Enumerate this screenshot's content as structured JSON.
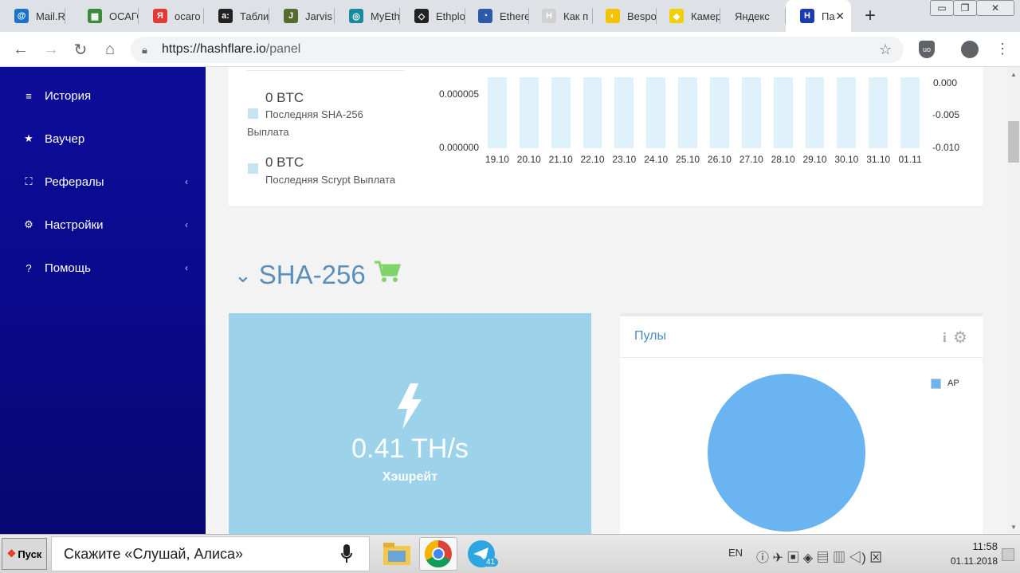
{
  "browser": {
    "tabs": [
      {
        "label": "Mail.Ru",
        "favicon": "@",
        "color": "#1a73c9"
      },
      {
        "label": "ОСАГО",
        "favicon": "▦",
        "color": "#3c8a3c"
      },
      {
        "label": "осаго",
        "favicon": "Я",
        "color": "#e53935"
      },
      {
        "label": "Табли",
        "favicon": "a:",
        "color": "#222222"
      },
      {
        "label": "Jarvis",
        "favicon": "J",
        "color": "#556b2f"
      },
      {
        "label": "MyEth",
        "favicon": "◎",
        "color": "#1b8a9c"
      },
      {
        "label": "Ethplo",
        "favicon": "◇",
        "color": "#222222"
      },
      {
        "label": "Ethere",
        "favicon": "◔",
        "color": "#2d5aa6"
      },
      {
        "label": "Как п",
        "favicon": "H",
        "color": "#d0d0d0"
      },
      {
        "label": "Bespo",
        "favicon": "◐",
        "color": "#f3c200"
      },
      {
        "label": "Камер",
        "favicon": "◆",
        "color": "#f0d000"
      },
      {
        "label": "Яндекс",
        "favicon": "",
        "color": "#dee1e6"
      },
      {
        "label": "Па",
        "favicon": "H",
        "color": "#1c3bb0",
        "active": true
      }
    ],
    "new_tab": "+",
    "url_host": "https://hashflare.io",
    "url_path": "/panel",
    "window_controls": [
      "minimize",
      "restore",
      "close"
    ]
  },
  "sidebar": {
    "items": [
      {
        "label": "История",
        "icon": "list-icon",
        "glyph": "≡",
        "submenu": false
      },
      {
        "label": "Ваучер",
        "icon": "star-icon",
        "glyph": "★",
        "submenu": false
      },
      {
        "label": "Рефералы",
        "icon": "network-icon",
        "glyph": "⛶",
        "submenu": true
      },
      {
        "label": "Настройки",
        "icon": "cogs-icon",
        "glyph": "⚙",
        "submenu": true
      },
      {
        "label": "Помощь",
        "icon": "question-icon",
        "glyph": "?",
        "submenu": true
      }
    ]
  },
  "payouts": {
    "sha": {
      "amount": "0 BTC",
      "label_line1": "Последняя SHA-256",
      "label_line2": "Выплата"
    },
    "scrypt": {
      "amount": "0 BTC",
      "label": "Последняя Scrypt Выплата"
    }
  },
  "chart_data": {
    "type": "bar",
    "categories": [
      "19.10",
      "20.10",
      "21.10",
      "22.10",
      "23.10",
      "24.10",
      "25.10",
      "26.10",
      "27.10",
      "28.10",
      "29.10",
      "30.10",
      "31.10",
      "01.11"
    ],
    "values": [
      1e-05,
      1e-05,
      1e-05,
      1e-05,
      1e-05,
      1e-05,
      1e-05,
      1e-05,
      1e-05,
      1e-05,
      1e-05,
      1e-05,
      1e-05,
      1e-05
    ],
    "y_left_ticks": [
      "0.000005",
      "0.000000"
    ],
    "y_right_ticks": [
      "0.000",
      "-0.005",
      "-0.010"
    ],
    "bar_color": "#dff2fb"
  },
  "sha256": {
    "title": "SHA-256",
    "hashrate_value": "0.41 TH/s",
    "hashrate_label": "Хэшрейт",
    "cart_color": "#7ed36a"
  },
  "pools": {
    "title": "Пулы",
    "legend": "AP",
    "pie_color": "#6ab4f2",
    "share": 1
  },
  "taskbar": {
    "start_label": "Пуск",
    "assistant_prompt": "Скажите «Слушай, Алиса»",
    "telegram_badge": "41",
    "language": "EN",
    "time": "11:58",
    "date": "01.11.2018"
  }
}
